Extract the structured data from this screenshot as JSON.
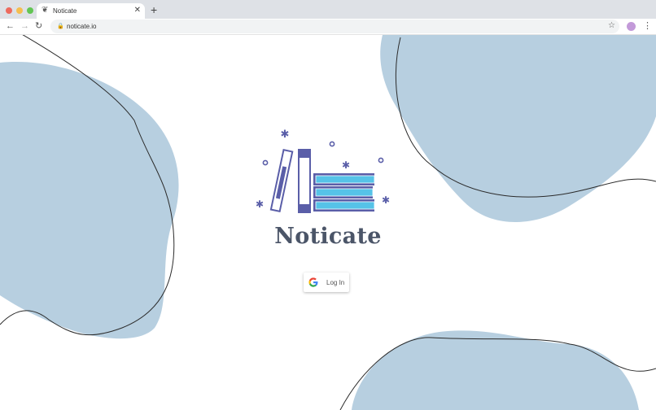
{
  "browser": {
    "tab_title": "Noticate",
    "tab_icon": "feather-icon",
    "url": "noticate.io",
    "window_dots": [
      "#ee6a5e",
      "#f5be4f",
      "#62c554"
    ],
    "avatar_color": "#c39ad9"
  },
  "page": {
    "brand_name": "Noticate",
    "login_label": "Log In",
    "colors": {
      "blob": "#b7cfe0",
      "brand_text": "#4b5568",
      "logo_primary": "#5a5ea8",
      "logo_accent": "#56c3e8"
    }
  }
}
